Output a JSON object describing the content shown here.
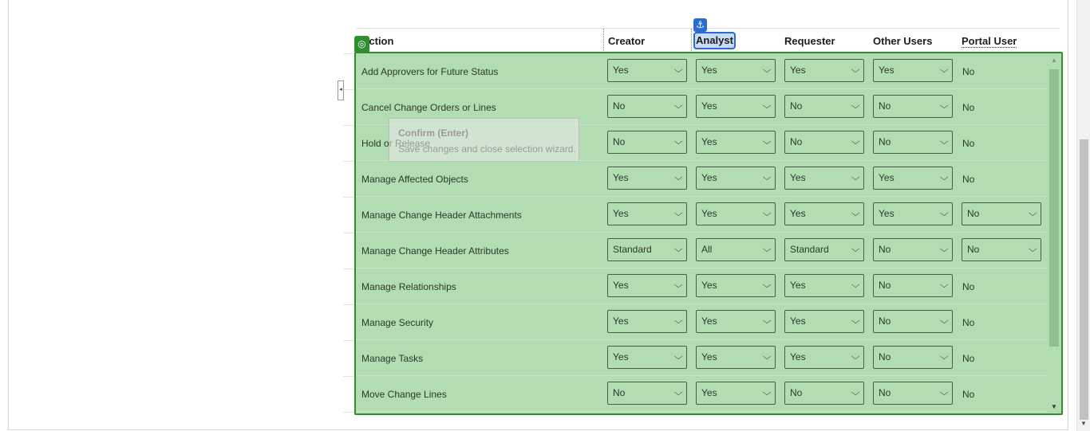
{
  "columns": {
    "action": "Action",
    "creator": "Creator",
    "analyst": "Analyst",
    "requester": "Requester",
    "other_users": "Other Users",
    "portal_user": "Portal User"
  },
  "tooltip": {
    "title": "Confirm (Enter)",
    "description": "Save changes and close selection wizard."
  },
  "icons": {
    "anchor": "anchor-icon",
    "target": "target-icon",
    "collapse": "collapse-left-icon"
  },
  "colors": {
    "overlay_fill": "#b2dcb2",
    "overlay_border": "#2f8f2f",
    "highlight_blue": "#2a6cd6"
  },
  "rows": [
    {
      "action": "Add Approvers for Future Status",
      "creator": "Yes",
      "analyst": "Yes",
      "requester": "Yes",
      "other_users": "Yes",
      "portal_user": "No",
      "portal_is_select": false
    },
    {
      "action": "Cancel Change Orders or Lines",
      "creator": "No",
      "analyst": "Yes",
      "requester": "No",
      "other_users": "No",
      "portal_user": "No",
      "portal_is_select": false
    },
    {
      "action": "Hold or Release",
      "creator": "No",
      "analyst": "Yes",
      "requester": "No",
      "other_users": "No",
      "portal_user": "No",
      "portal_is_select": false
    },
    {
      "action": "Manage Affected Objects",
      "creator": "Yes",
      "analyst": "Yes",
      "requester": "Yes",
      "other_users": "Yes",
      "portal_user": "No",
      "portal_is_select": false
    },
    {
      "action": "Manage Change Header Attachments",
      "creator": "Yes",
      "analyst": "Yes",
      "requester": "Yes",
      "other_users": "Yes",
      "portal_user": "No",
      "portal_is_select": true
    },
    {
      "action": "Manage Change Header Attributes",
      "creator": "Standard",
      "analyst": "All",
      "requester": "Standard",
      "other_users": "No",
      "portal_user": "No",
      "portal_is_select": true
    },
    {
      "action": "Manage Relationships",
      "creator": "Yes",
      "analyst": "Yes",
      "requester": "Yes",
      "other_users": "No",
      "portal_user": "No",
      "portal_is_select": false
    },
    {
      "action": "Manage Security",
      "creator": "Yes",
      "analyst": "Yes",
      "requester": "Yes",
      "other_users": "No",
      "portal_user": "No",
      "portal_is_select": false
    },
    {
      "action": "Manage Tasks",
      "creator": "Yes",
      "analyst": "Yes",
      "requester": "Yes",
      "other_users": "No",
      "portal_user": "No",
      "portal_is_select": false
    },
    {
      "action": "Move Change Lines",
      "creator": "No",
      "analyst": "Yes",
      "requester": "No",
      "other_users": "No",
      "portal_user": "No",
      "portal_is_select": false
    }
  ]
}
